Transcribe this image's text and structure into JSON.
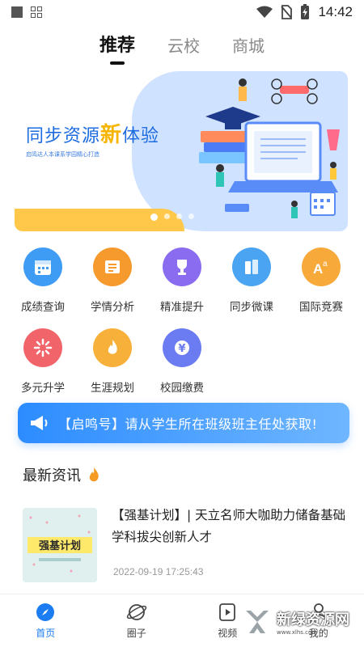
{
  "status_bar": {
    "time": "14:42"
  },
  "top_tabs": [
    {
      "label": "推荐",
      "active": true
    },
    {
      "label": "云校",
      "active": false
    },
    {
      "label": "商城",
      "active": false
    }
  ],
  "banner": {
    "title_prefix": "同步资源",
    "title_highlight": "新",
    "title_suffix": "体验",
    "subtitle": "启鸣达人本课系学园精心打造",
    "dots": 4,
    "active_dot": 0
  },
  "grid_items": [
    {
      "label": "成绩查询",
      "icon": "calendar-icon",
      "color": "#3f9cf4"
    },
    {
      "label": "学情分析",
      "icon": "report-icon",
      "color": "#f79a2e"
    },
    {
      "label": "精准提升",
      "icon": "trophy-icon",
      "color": "#8a6cf0"
    },
    {
      "label": "同步微课",
      "icon": "books-icon",
      "color": "#4aa4f2"
    },
    {
      "label": "国际竞赛",
      "icon": "font-icon",
      "color": "#f7a93a"
    },
    {
      "label": "多元升学",
      "icon": "burst-icon",
      "color": "#f0646a"
    },
    {
      "label": "生涯规划",
      "icon": "flame-icon",
      "color": "#f7b13a"
    },
    {
      "label": "校园缴费",
      "icon": "yuan-icon",
      "color": "#6b7cf2"
    }
  ],
  "notice": {
    "text": "【启鸣号】请从学生所在班级班主任处获取!"
  },
  "news": {
    "heading": "最新资讯",
    "items": [
      {
        "title": "【强基计划】| 天立名师大咖助力储备基础学科拔尖创新人才",
        "time": "2022-09-19 17:25:43",
        "thumb_text": "强基计划"
      }
    ]
  },
  "bottom_nav": [
    {
      "label": "首页",
      "icon": "compass-icon",
      "active": true
    },
    {
      "label": "圈子",
      "icon": "planet-icon",
      "active": false
    },
    {
      "label": "视频",
      "icon": "video-icon",
      "active": false
    },
    {
      "label": "我的",
      "icon": "person-icon",
      "active": false
    }
  ],
  "watermark": {
    "text": "新绿资源网",
    "sub": "www.xlhs.com"
  },
  "colors": {
    "accent": "#1c7cf2",
    "notice_start": "#2c8cff",
    "notice_end": "#6fb6ff"
  }
}
